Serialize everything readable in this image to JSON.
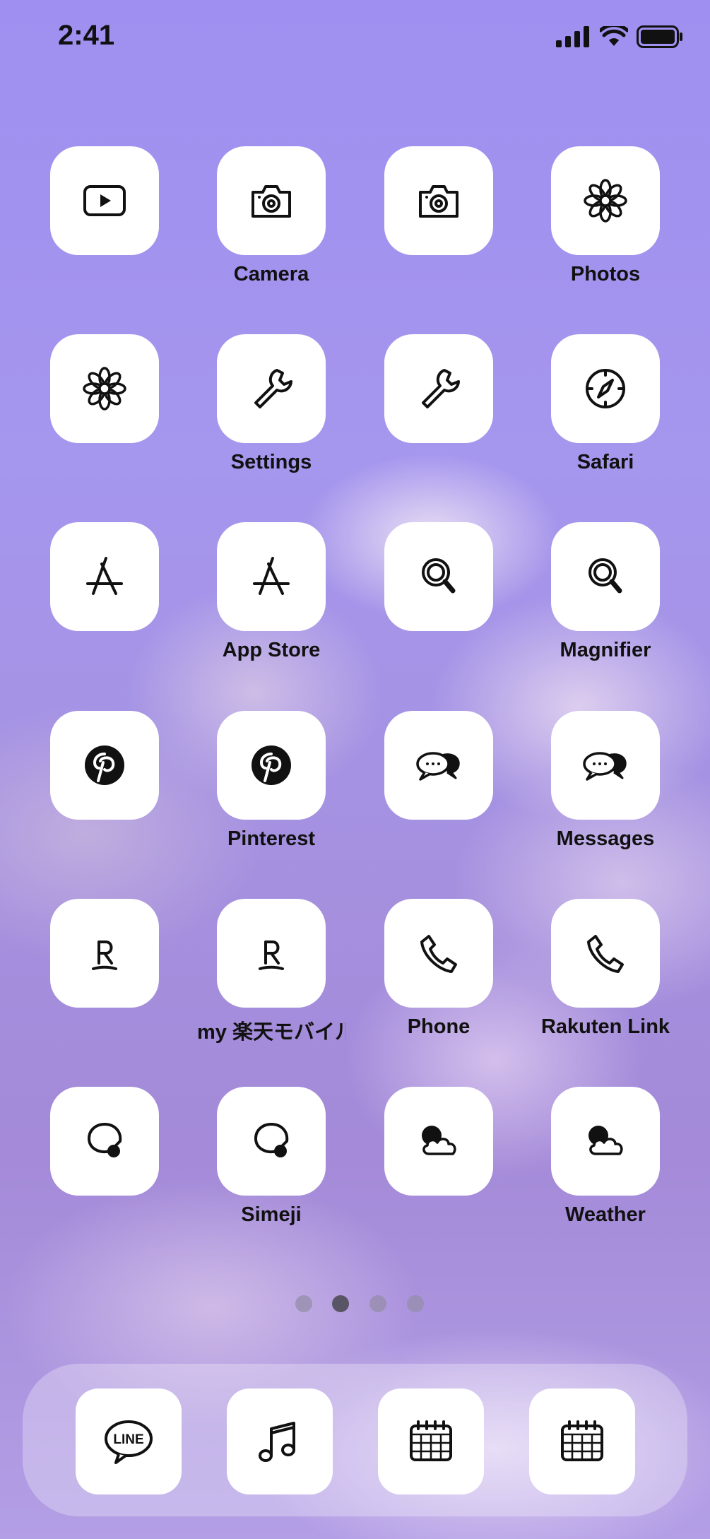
{
  "status_bar": {
    "time": "2:41"
  },
  "home": {
    "rows": [
      [
        {
          "icon": "youtube-icon",
          "label": ""
        },
        {
          "icon": "camera-icon",
          "label": "Camera"
        },
        {
          "icon": "camera-icon",
          "label": ""
        },
        {
          "icon": "flower-icon",
          "label": "Photos"
        }
      ],
      [
        {
          "icon": "flower-icon",
          "label": ""
        },
        {
          "icon": "wrench-icon",
          "label": "Settings"
        },
        {
          "icon": "wrench-icon",
          "label": ""
        },
        {
          "icon": "compass-icon",
          "label": "Safari"
        }
      ],
      [
        {
          "icon": "app-store-icon",
          "label": ""
        },
        {
          "icon": "app-store-icon",
          "label": "App Store"
        },
        {
          "icon": "magnifier-icon",
          "label": ""
        },
        {
          "icon": "magnifier-icon",
          "label": "Magnifier"
        }
      ],
      [
        {
          "icon": "pinterest-icon",
          "label": ""
        },
        {
          "icon": "pinterest-icon",
          "label": "Pinterest"
        },
        {
          "icon": "chat-bubbles-icon",
          "label": ""
        },
        {
          "icon": "chat-bubbles-icon",
          "label": "Messages"
        }
      ],
      [
        {
          "icon": "rakuten-r-icon",
          "label": ""
        },
        {
          "icon": "rakuten-r-icon",
          "label": "my 楽天モバイル"
        },
        {
          "icon": "phone-icon",
          "label": "Phone"
        },
        {
          "icon": "phone-icon",
          "label": "Rakuten Link"
        }
      ],
      [
        {
          "icon": "simeji-icon",
          "label": ""
        },
        {
          "icon": "simeji-icon",
          "label": "Simeji"
        },
        {
          "icon": "weather-icon",
          "label": ""
        },
        {
          "icon": "weather-icon",
          "label": "Weather"
        }
      ]
    ]
  },
  "page_indicator": {
    "count": 4,
    "active": 2
  },
  "dock": {
    "apps": [
      {
        "icon": "line-icon",
        "text": "LINE"
      },
      {
        "icon": "music-note-icon",
        "text": ""
      },
      {
        "icon": "calendar-icon",
        "text": ""
      },
      {
        "icon": "calendar-icon",
        "text": ""
      }
    ]
  },
  "colors": {
    "icon_background": "#ffffff",
    "label": "#111111",
    "wallpaper": "#a596ee"
  }
}
